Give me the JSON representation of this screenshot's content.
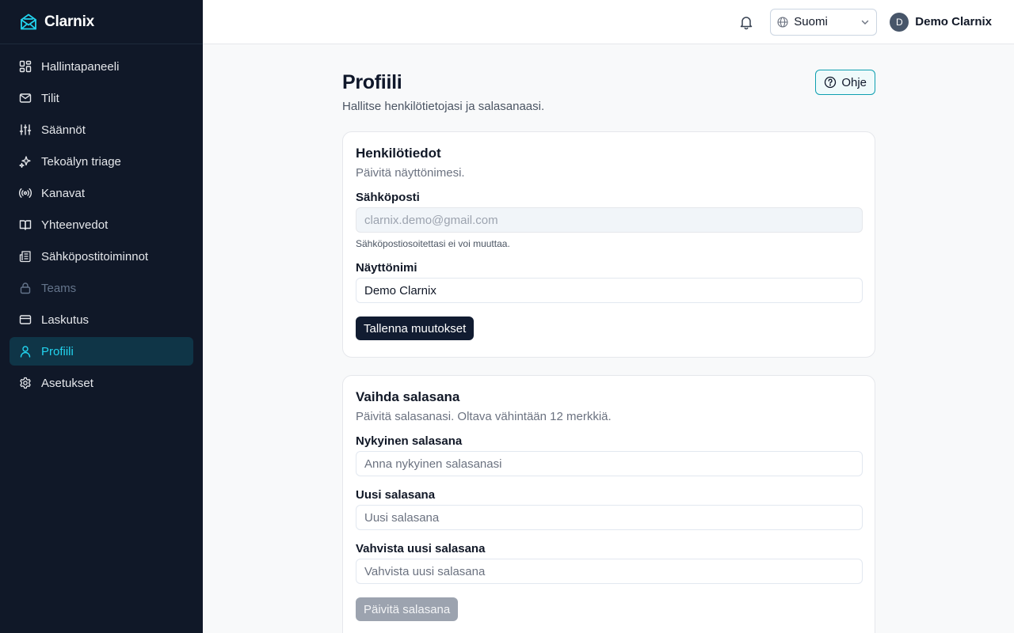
{
  "app": {
    "name": "Clarnix"
  },
  "sidebar": {
    "items": [
      {
        "label": "Hallintapaneeli",
        "icon": "dashboard-icon"
      },
      {
        "label": "Tilit",
        "icon": "mail-icon"
      },
      {
        "label": "Säännöt",
        "icon": "sliders-icon"
      },
      {
        "label": "Tekoälyn triage",
        "icon": "sparkles-icon"
      },
      {
        "label": "Kanavat",
        "icon": "radio-icon"
      },
      {
        "label": "Yhteenvedot",
        "icon": "book-icon"
      },
      {
        "label": "Sähköpostitoiminnot",
        "icon": "newspaper-icon"
      },
      {
        "label": "Teams",
        "icon": "lock-icon",
        "state": "disabled"
      },
      {
        "label": "Laskutus",
        "icon": "credit-card-icon"
      },
      {
        "label": "Profiili",
        "icon": "user-icon",
        "state": "active"
      },
      {
        "label": "Asetukset",
        "icon": "gear-icon"
      }
    ]
  },
  "header": {
    "language": "Suomi",
    "user": {
      "initial": "D",
      "name": "Demo Clarnix"
    }
  },
  "page": {
    "title": "Profiili",
    "subtitle": "Hallitse henkilötietojasi ja salasanaasi.",
    "help_label": "Ohje"
  },
  "personal": {
    "title": "Henkilötiedot",
    "description": "Päivitä näyttönimesi.",
    "email_label": "Sähköposti",
    "email_value": "clarnix.demo@gmail.com",
    "email_hint": "Sähköpostiosoitettasi ei voi muuttaa.",
    "display_name_label": "Näyttönimi",
    "display_name_value": "Demo Clarnix",
    "save_label": "Tallenna muutokset"
  },
  "password": {
    "title": "Vaihda salasana",
    "description": "Päivitä salasanasi. Oltava vähintään 12 merkkiä.",
    "current_label": "Nykyinen salasana",
    "current_placeholder": "Anna nykyinen salasanasi",
    "new_label": "Uusi salasana",
    "new_placeholder": "Uusi salasana",
    "confirm_label": "Vahvista uusi salasana",
    "confirm_placeholder": "Vahvista uusi salasana",
    "update_label": "Päivitä salasana"
  },
  "colors": {
    "sidebar_bg": "#101828",
    "accent": "#22d3ee",
    "primary_button": "#111c31"
  }
}
